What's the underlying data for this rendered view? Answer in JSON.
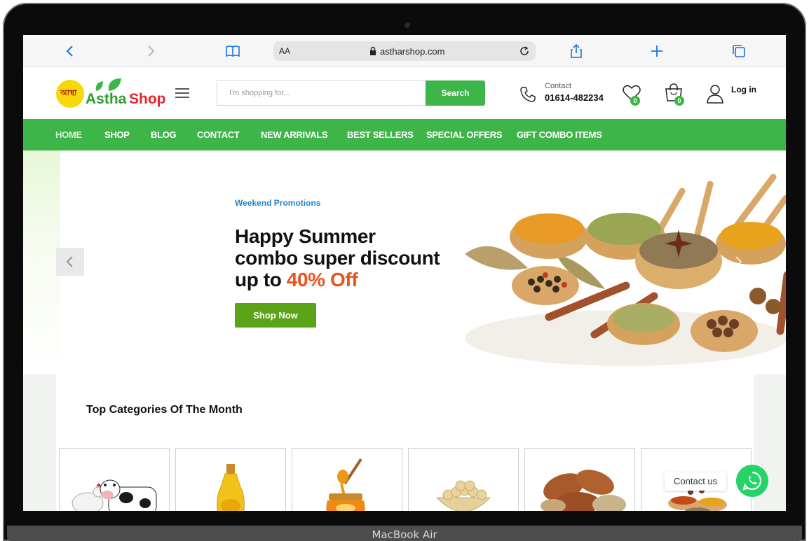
{
  "device": {
    "label": "MacBook Air"
  },
  "browser": {
    "text_size_label": "AA",
    "url": "astharshop.com"
  },
  "header": {
    "logo_circle_text": "আস্থা",
    "logo_word1": "Astha",
    "logo_word2": "Shop",
    "search_placeholder": "I'm shopping for...",
    "search_button": "Search",
    "contact_label": "Contact",
    "contact_number": "01614-482234",
    "wishlist_count": "0",
    "cart_count": "0",
    "login_label": "Log in"
  },
  "nav": {
    "items": [
      "HOME",
      "SHOP",
      "BLOG",
      "CONTACT",
      "NEW ARRIVALS",
      "BEST SELLERS",
      "SPECIAL OFFERS",
      "GIFT COMBO ITEMS"
    ],
    "active": "HOME"
  },
  "hero": {
    "eyebrow": "Weekend Promotions",
    "title_line1": "Happy Summer",
    "title_line2": "combo super discount",
    "title_line3_prefix": "up to ",
    "title_highlight": "40% Off",
    "cta": "Shop Now",
    "highlight_color": "#e8531e"
  },
  "categories": {
    "title": "Top Categories Of The Month",
    "card_icons": [
      "livestock-icon",
      "oil-bottle-icon",
      "honey-jar-icon",
      "legumes-bowl-icon",
      "nuts-icon",
      "spices-icon"
    ]
  },
  "whatsapp": {
    "label": "Contact us"
  },
  "colors": {
    "brand_green": "#3eb549",
    "cta_green": "#5ba317",
    "link_blue": "#1f86c7",
    "logo_red": "#e4242d"
  }
}
